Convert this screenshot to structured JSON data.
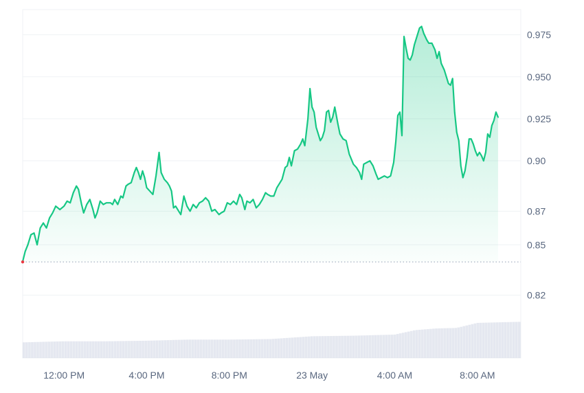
{
  "colors": {
    "line": "#16c784",
    "area_top": "#16c784",
    "grid": "#eff2f5",
    "axis_text": "#58667e",
    "baseline": "#a6b0c3",
    "start_marker": "#ea3943",
    "volume": "#cfd6e4"
  },
  "chart_data": {
    "type": "area",
    "title": "",
    "xlabel": "",
    "ylabel": "",
    "ylim": [
      0.79,
      0.99
    ],
    "yticks": [
      0.82,
      0.85,
      0.87,
      0.9,
      0.925,
      0.95,
      0.975
    ],
    "ytick_labels": [
      "0.82",
      "0.85",
      "0.87",
      "0.90",
      "0.925",
      "0.950",
      "0.975"
    ],
    "xtick_labels": [
      "12:00 PM",
      "4:00 PM",
      "8:00 PM",
      "23 May",
      "4:00 AM",
      "8:00 AM"
    ],
    "xtick_hours": [
      2,
      6,
      10,
      14,
      18,
      22
    ],
    "x_range_hours": [
      0,
      24.1
    ],
    "baseline_value": 0.8398,
    "grid": true,
    "series": [
      {
        "points": [
          [
            0.0,
            0.84
          ],
          [
            0.12,
            0.846
          ],
          [
            0.25,
            0.85
          ],
          [
            0.4,
            0.856
          ],
          [
            0.55,
            0.857
          ],
          [
            0.7,
            0.85
          ],
          [
            0.85,
            0.86
          ],
          [
            1.0,
            0.863
          ],
          [
            1.15,
            0.86
          ],
          [
            1.3,
            0.866
          ],
          [
            1.45,
            0.869
          ],
          [
            1.6,
            0.873
          ],
          [
            1.8,
            0.871
          ],
          [
            2.0,
            0.873
          ],
          [
            2.15,
            0.876
          ],
          [
            2.3,
            0.875
          ],
          [
            2.45,
            0.881
          ],
          [
            2.6,
            0.885
          ],
          [
            2.7,
            0.883
          ],
          [
            2.85,
            0.874
          ],
          [
            2.95,
            0.869
          ],
          [
            3.1,
            0.874
          ],
          [
            3.25,
            0.877
          ],
          [
            3.4,
            0.871
          ],
          [
            3.5,
            0.866
          ],
          [
            3.6,
            0.869
          ],
          [
            3.75,
            0.876
          ],
          [
            3.9,
            0.874
          ],
          [
            4.05,
            0.875
          ],
          [
            4.25,
            0.875
          ],
          [
            4.35,
            0.874
          ],
          [
            4.45,
            0.877
          ],
          [
            4.6,
            0.874
          ],
          [
            4.75,
            0.879
          ],
          [
            4.85,
            0.878
          ],
          [
            5.0,
            0.885
          ],
          [
            5.1,
            0.886
          ],
          [
            5.25,
            0.887
          ],
          [
            5.4,
            0.893
          ],
          [
            5.5,
            0.896
          ],
          [
            5.6,
            0.893
          ],
          [
            5.7,
            0.889
          ],
          [
            5.8,
            0.894
          ],
          [
            5.9,
            0.89
          ],
          [
            6.0,
            0.884
          ],
          [
            6.15,
            0.882
          ],
          [
            6.3,
            0.88
          ],
          [
            6.45,
            0.891
          ],
          [
            6.6,
            0.905
          ],
          [
            6.7,
            0.893
          ],
          [
            6.85,
            0.889
          ],
          [
            7.0,
            0.887
          ],
          [
            7.1,
            0.885
          ],
          [
            7.2,
            0.882
          ],
          [
            7.3,
            0.872
          ],
          [
            7.4,
            0.873
          ],
          [
            7.5,
            0.871
          ],
          [
            7.65,
            0.868
          ],
          [
            7.8,
            0.879
          ],
          [
            7.95,
            0.873
          ],
          [
            8.1,
            0.87
          ],
          [
            8.25,
            0.874
          ],
          [
            8.4,
            0.872
          ],
          [
            8.55,
            0.875
          ],
          [
            8.7,
            0.876
          ],
          [
            8.85,
            0.878
          ],
          [
            9.0,
            0.876
          ],
          [
            9.15,
            0.87
          ],
          [
            9.3,
            0.871
          ],
          [
            9.5,
            0.868
          ],
          [
            9.6,
            0.869
          ],
          [
            9.75,
            0.87
          ],
          [
            9.9,
            0.875
          ],
          [
            10.05,
            0.874
          ],
          [
            10.2,
            0.876
          ],
          [
            10.35,
            0.874
          ],
          [
            10.5,
            0.88
          ],
          [
            10.6,
            0.878
          ],
          [
            10.75,
            0.871
          ],
          [
            10.85,
            0.876
          ],
          [
            11.0,
            0.875
          ],
          [
            11.15,
            0.877
          ],
          [
            11.3,
            0.872
          ],
          [
            11.45,
            0.874
          ],
          [
            11.6,
            0.877
          ],
          [
            11.75,
            0.881
          ],
          [
            11.85,
            0.88
          ],
          [
            12.0,
            0.879
          ],
          [
            12.15,
            0.879
          ],
          [
            12.3,
            0.884
          ],
          [
            12.4,
            0.886
          ],
          [
            12.55,
            0.889
          ],
          [
            12.7,
            0.896
          ],
          [
            12.8,
            0.897
          ],
          [
            12.9,
            0.902
          ],
          [
            13.0,
            0.897
          ],
          [
            13.15,
            0.906
          ],
          [
            13.3,
            0.907
          ],
          [
            13.45,
            0.91
          ],
          [
            13.55,
            0.913
          ],
          [
            13.65,
            0.909
          ],
          [
            13.8,
            0.925
          ],
          [
            13.9,
            0.943
          ],
          [
            14.0,
            0.932
          ],
          [
            14.1,
            0.929
          ],
          [
            14.2,
            0.92
          ],
          [
            14.3,
            0.916
          ],
          [
            14.4,
            0.912
          ],
          [
            14.5,
            0.914
          ],
          [
            14.6,
            0.918
          ],
          [
            14.7,
            0.929
          ],
          [
            14.8,
            0.93
          ],
          [
            14.9,
            0.923
          ],
          [
            15.0,
            0.926
          ],
          [
            15.1,
            0.932
          ],
          [
            15.25,
            0.922
          ],
          [
            15.35,
            0.916
          ],
          [
            15.5,
            0.913
          ],
          [
            15.65,
            0.912
          ],
          [
            15.8,
            0.904
          ],
          [
            15.9,
            0.901
          ],
          [
            16.0,
            0.898
          ],
          [
            16.15,
            0.896
          ],
          [
            16.3,
            0.893
          ],
          [
            16.4,
            0.889
          ],
          [
            16.5,
            0.898
          ],
          [
            16.65,
            0.899
          ],
          [
            16.8,
            0.9
          ],
          [
            16.95,
            0.897
          ],
          [
            17.1,
            0.892
          ],
          [
            17.2,
            0.889
          ],
          [
            17.35,
            0.89
          ],
          [
            17.5,
            0.891
          ],
          [
            17.65,
            0.89
          ],
          [
            17.8,
            0.891
          ],
          [
            17.95,
            0.899
          ],
          [
            18.05,
            0.911
          ],
          [
            18.15,
            0.927
          ],
          [
            18.25,
            0.929
          ],
          [
            18.35,
            0.915
          ],
          [
            18.45,
            0.974
          ],
          [
            18.55,
            0.967
          ],
          [
            18.65,
            0.961
          ],
          [
            18.75,
            0.96
          ],
          [
            18.85,
            0.963
          ],
          [
            18.95,
            0.969
          ],
          [
            19.05,
            0.973
          ],
          [
            19.2,
            0.979
          ],
          [
            19.3,
            0.98
          ],
          [
            19.4,
            0.976
          ],
          [
            19.55,
            0.972
          ],
          [
            19.65,
            0.97
          ],
          [
            19.8,
            0.97
          ],
          [
            19.95,
            0.966
          ],
          [
            20.05,
            0.961
          ],
          [
            20.15,
            0.965
          ],
          [
            20.25,
            0.958
          ],
          [
            20.4,
            0.954
          ],
          [
            20.5,
            0.95
          ],
          [
            20.6,
            0.946
          ],
          [
            20.7,
            0.945
          ],
          [
            20.8,
            0.949
          ],
          [
            20.9,
            0.929
          ],
          [
            21.0,
            0.917
          ],
          [
            21.1,
            0.912
          ],
          [
            21.2,
            0.897
          ],
          [
            21.3,
            0.89
          ],
          [
            21.4,
            0.894
          ],
          [
            21.5,
            0.902
          ],
          [
            21.6,
            0.913
          ],
          [
            21.7,
            0.913
          ],
          [
            21.8,
            0.91
          ],
          [
            21.9,
            0.906
          ],
          [
            22.0,
            0.903
          ],
          [
            22.1,
            0.905
          ],
          [
            22.2,
            0.903
          ],
          [
            22.3,
            0.9
          ],
          [
            22.4,
            0.905
          ],
          [
            22.5,
            0.916
          ],
          [
            22.6,
            0.914
          ],
          [
            22.7,
            0.921
          ],
          [
            22.8,
            0.924
          ],
          [
            22.9,
            0.929
          ],
          [
            23.0,
            0.926
          ]
        ]
      }
    ],
    "volume": [
      [
        0.0,
        0.28
      ],
      [
        2.0,
        0.3
      ],
      [
        4.0,
        0.3
      ],
      [
        6.0,
        0.31
      ],
      [
        8.0,
        0.33
      ],
      [
        10.0,
        0.33
      ],
      [
        12.0,
        0.34
      ],
      [
        14.0,
        0.39
      ],
      [
        16.0,
        0.4
      ],
      [
        18.0,
        0.42
      ],
      [
        19.0,
        0.5
      ],
      [
        20.0,
        0.53
      ],
      [
        21.0,
        0.54
      ],
      [
        22.0,
        0.63
      ],
      [
        23.0,
        0.64
      ],
      [
        24.1,
        0.65
      ]
    ]
  }
}
